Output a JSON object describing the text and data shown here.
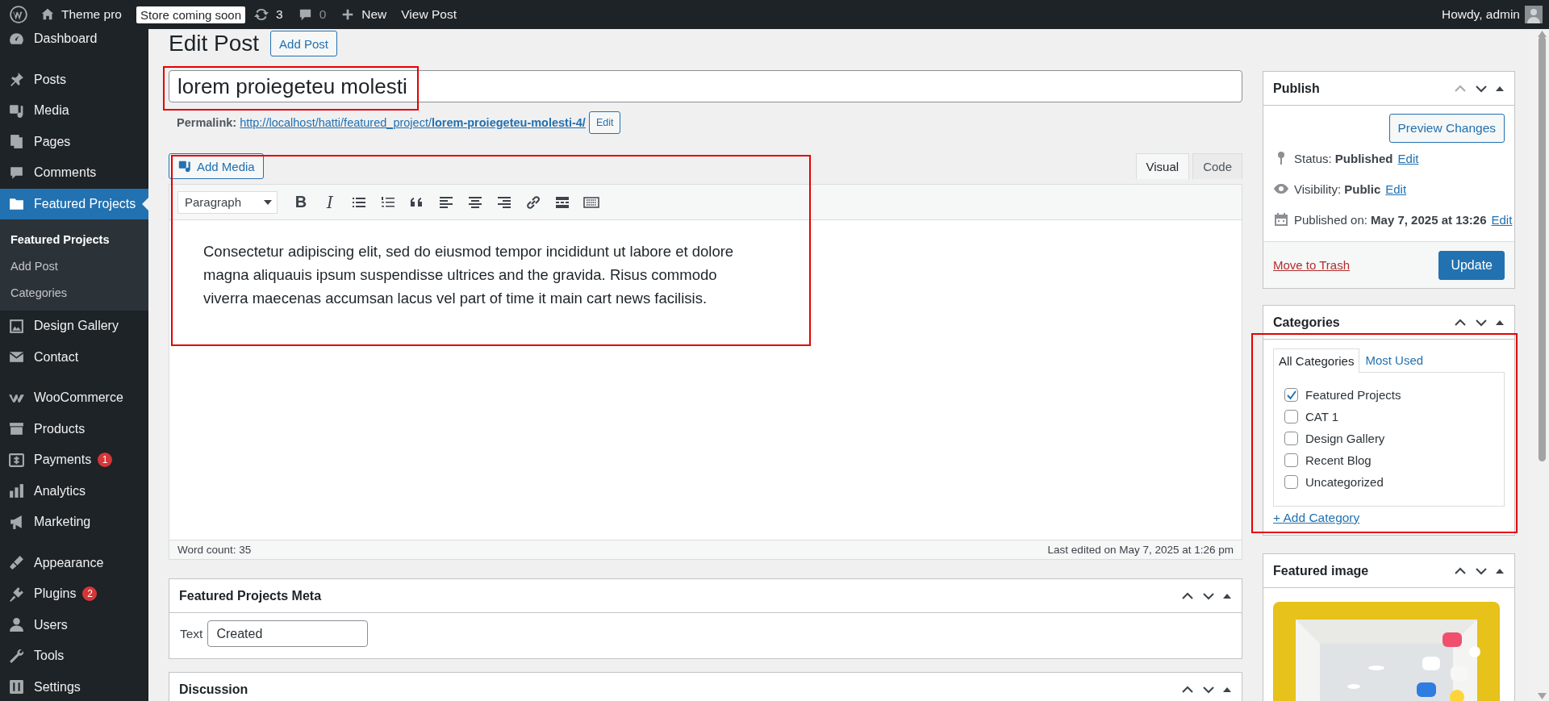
{
  "admin_bar": {
    "site_name": "Theme pro",
    "store_badge": "Store coming soon",
    "updates_count": "3",
    "comments_count": "0",
    "new_label": "New",
    "view_post": "View Post",
    "greeting": "Howdy, admin"
  },
  "sidebar": {
    "groups": [
      [
        {
          "label": "Dashboard",
          "selected": false
        }
      ],
      [
        {
          "label": "Posts",
          "selected": false
        },
        {
          "label": "Media",
          "selected": false
        },
        {
          "label": "Pages",
          "selected": false
        },
        {
          "label": "Comments",
          "selected": false
        },
        {
          "label": "Featured Projects",
          "selected": true,
          "children": [
            {
              "label": "Featured Projects",
              "selected": true
            },
            {
              "label": "Add Post",
              "selected": false
            },
            {
              "label": "Categories",
              "selected": false
            }
          ]
        },
        {
          "label": "Design Gallery",
          "selected": false
        },
        {
          "label": "Contact",
          "selected": false
        }
      ],
      [
        {
          "label": "WooCommerce",
          "selected": false
        },
        {
          "label": "Products",
          "selected": false
        },
        {
          "label": "Payments",
          "selected": false,
          "badge": "1"
        },
        {
          "label": "Analytics",
          "selected": false
        },
        {
          "label": "Marketing",
          "selected": false
        }
      ],
      [
        {
          "label": "Appearance",
          "selected": false
        },
        {
          "label": "Plugins",
          "selected": false,
          "badge": "2"
        },
        {
          "label": "Users",
          "selected": false
        },
        {
          "label": "Tools",
          "selected": false
        },
        {
          "label": "Settings",
          "selected": false
        }
      ]
    ]
  },
  "page": {
    "heading": "Edit Post",
    "add_button": "Add Post"
  },
  "title_field": {
    "value": "lorem proiegeteu molesti"
  },
  "permalink": {
    "label": "Permalink:",
    "url": "http://localhost/hatti/featured_project/**lorem-proiegeteu-molesti-4/**",
    "edit": "Edit"
  },
  "editor": {
    "add_media": "Add Media",
    "tabs": [
      {
        "label": "Visual",
        "selected": true
      },
      {
        "label": "Code",
        "selected": false
      }
    ],
    "format": "Paragraph",
    "toolbar": [
      {
        "kind": "bold",
        "glyph": "B"
      },
      {
        "kind": "italic",
        "glyph": "I"
      },
      {
        "kind": "bullets"
      },
      {
        "kind": "numbers"
      },
      {
        "kind": "quote"
      },
      {
        "kind": "align-left"
      },
      {
        "kind": "align-center"
      },
      {
        "kind": "align-right"
      },
      {
        "kind": "link"
      },
      {
        "kind": "more"
      },
      {
        "kind": "keyboard"
      }
    ],
    "content": "Consectetur adipiscing elit, sed do eiusmod tempor incididunt ut labore et dolore magna aliquauis ipsum suspendisse ultrices and the gravida. Risus commodo viverra maecenas accumsan lacus vel part of time it main cart news facilisis.",
    "word_count": "Word count: 35",
    "last_edited": "Last edited on May 7, 2025 at 1:26 pm"
  },
  "meta_box": {
    "title": "Featured Projects Meta",
    "field_label": "Text",
    "field_value": "Created"
  },
  "discussion": {
    "title": "Discussion"
  },
  "publish": {
    "title": "Publish",
    "preview": "Preview Changes",
    "rows": [
      {
        "text": "Status: **Published**",
        "link": "Edit"
      },
      {
        "text": "Visibility: **Public**",
        "link": "Edit"
      },
      {
        "text": "Published on: **May 7, 2025 at 13:26**",
        "link": "Edit"
      }
    ],
    "trash": "Move to Trash",
    "update": "Update"
  },
  "categories": {
    "title": "Categories",
    "tabs": [
      {
        "label": "All Categories",
        "selected": true
      },
      {
        "label": "Most Used",
        "selected": false
      }
    ],
    "items": [
      {
        "label": "Featured Projects",
        "checked": true
      },
      {
        "label": "CAT 1",
        "checked": false
      },
      {
        "label": "Design Gallery",
        "checked": false
      },
      {
        "label": "Recent Blog",
        "checked": false
      },
      {
        "label": "Uncategorized",
        "checked": false
      }
    ],
    "add": "+ Add Category"
  },
  "featured_image": {
    "title": "Featured image"
  }
}
